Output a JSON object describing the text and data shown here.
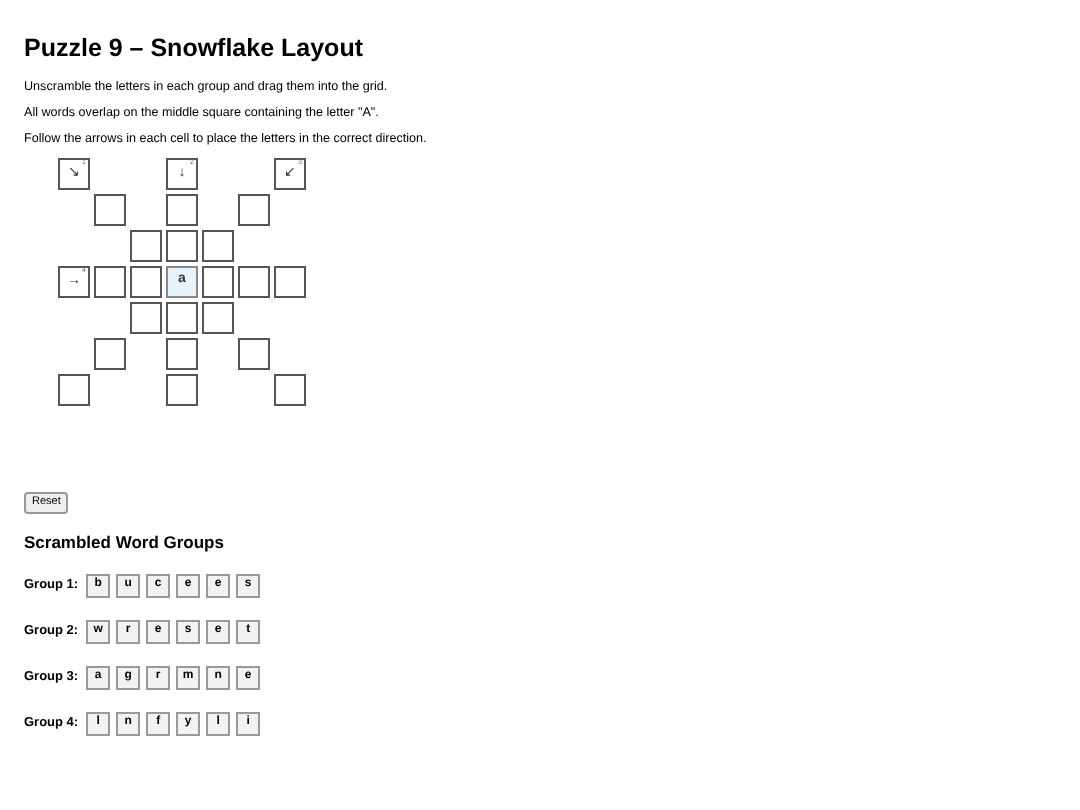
{
  "title": "Puzzle 9 – Snowflake Layout",
  "instructions": [
    "Unscramble the letters in each group and drag them into the grid.",
    "All words overlap on the middle square containing the letter \"A\".",
    "Follow the arrows in each cell to place the letters in the correct direction."
  ],
  "grid": [
    [
      {
        "kind": "clue",
        "number": "1",
        "arrow": "↘"
      },
      {
        "kind": "blank"
      },
      {
        "kind": "blank"
      },
      {
        "kind": "clue",
        "number": "2",
        "arrow": "↓"
      },
      {
        "kind": "blank"
      },
      {
        "kind": "blank"
      },
      {
        "kind": "clue",
        "number": "3",
        "arrow": "↙"
      }
    ],
    [
      {
        "kind": "blank"
      },
      {
        "kind": "cell"
      },
      {
        "kind": "blank"
      },
      {
        "kind": "cell"
      },
      {
        "kind": "blank"
      },
      {
        "kind": "cell"
      },
      {
        "kind": "blank"
      }
    ],
    [
      {
        "kind": "blank"
      },
      {
        "kind": "blank"
      },
      {
        "kind": "cell"
      },
      {
        "kind": "cell"
      },
      {
        "kind": "cell"
      },
      {
        "kind": "blank"
      },
      {
        "kind": "blank"
      }
    ],
    [
      {
        "kind": "clue",
        "number": "4",
        "arrow": "→"
      },
      {
        "kind": "cell"
      },
      {
        "kind": "cell"
      },
      {
        "kind": "letter",
        "letter": "a"
      },
      {
        "kind": "cell"
      },
      {
        "kind": "cell"
      },
      {
        "kind": "cell"
      }
    ],
    [
      {
        "kind": "blank"
      },
      {
        "kind": "blank"
      },
      {
        "kind": "cell"
      },
      {
        "kind": "cell"
      },
      {
        "kind": "cell"
      },
      {
        "kind": "blank"
      },
      {
        "kind": "blank"
      }
    ],
    [
      {
        "kind": "blank"
      },
      {
        "kind": "cell"
      },
      {
        "kind": "blank"
      },
      {
        "kind": "cell"
      },
      {
        "kind": "blank"
      },
      {
        "kind": "cell"
      },
      {
        "kind": "blank"
      }
    ],
    [
      {
        "kind": "cell"
      },
      {
        "kind": "blank"
      },
      {
        "kind": "blank"
      },
      {
        "kind": "cell"
      },
      {
        "kind": "blank"
      },
      {
        "kind": "blank"
      },
      {
        "kind": "cell"
      }
    ]
  ],
  "reset_button": "Reset",
  "groups_heading": "Scrambled Word Groups",
  "groups": [
    {
      "label": "Group 1:",
      "letters": [
        "b",
        "u",
        "c",
        "e",
        "e",
        "s"
      ]
    },
    {
      "label": "Group 2:",
      "letters": [
        "w",
        "r",
        "e",
        "s",
        "e",
        "t"
      ]
    },
    {
      "label": "Group 3:",
      "letters": [
        "a",
        "g",
        "r",
        "m",
        "n",
        "e"
      ]
    },
    {
      "label": "Group 4:",
      "letters": [
        "l",
        "n",
        "f",
        "y",
        "l",
        "i"
      ]
    }
  ]
}
